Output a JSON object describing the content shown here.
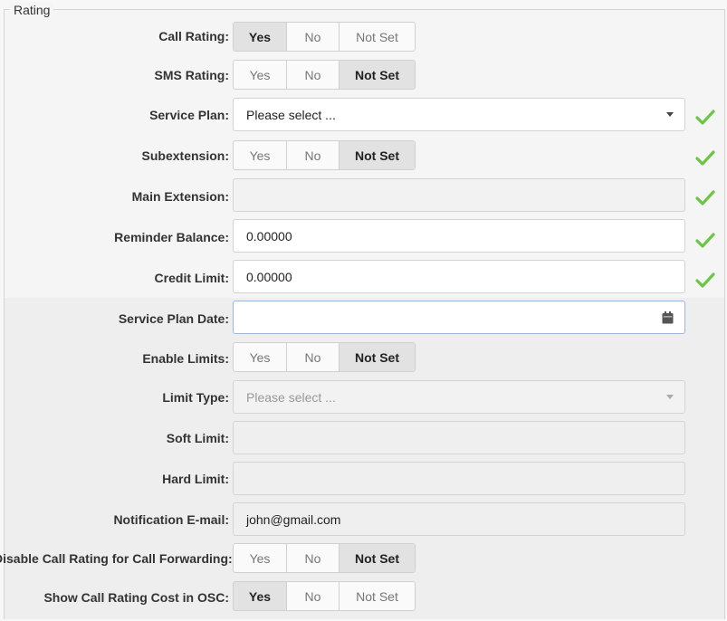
{
  "legend": "Rating",
  "options": {
    "yes": "Yes",
    "no": "No",
    "not_set": "Not Set"
  },
  "rows": {
    "call_rating": {
      "label": "Call Rating:",
      "selected": "Yes"
    },
    "sms_rating": {
      "label": "SMS Rating:",
      "selected": "Not Set"
    },
    "service_plan": {
      "label": "Service Plan:",
      "placeholder": "Please select ..."
    },
    "subextension": {
      "label": "Subextension:",
      "selected": "Not Set"
    },
    "main_extension": {
      "label": "Main Extension:",
      "value": ""
    },
    "reminder_balance": {
      "label": "Reminder Balance:",
      "value": "0.00000"
    },
    "credit_limit": {
      "label": "Credit Limit:",
      "value": "0.00000"
    },
    "service_plan_date": {
      "label": "Service Plan Date:",
      "value": ""
    },
    "enable_limits": {
      "label": "Enable Limits:",
      "selected": "Not Set"
    },
    "limit_type": {
      "label": "Limit Type:",
      "placeholder": "Please select ..."
    },
    "soft_limit": {
      "label": "Soft Limit:",
      "value": ""
    },
    "hard_limit": {
      "label": "Hard Limit:",
      "value": ""
    },
    "notification_email": {
      "label": "Notification E-mail:",
      "value": "john@gmail.com"
    },
    "disable_call_rating_forwarding": {
      "label": "Disable Call Rating for Call Forwarding:",
      "selected": "Not Set"
    },
    "show_call_rating_cost": {
      "label": "Show Call Rating Cost in OSC:",
      "selected": "Yes"
    }
  },
  "colors": {
    "check": "#6cc644",
    "active_option_bg": "#e2e2e2",
    "focus_border": "#9bb6d6"
  },
  "icons": {
    "check": "check-icon",
    "calendar": "calendar-icon",
    "dropdown": "chevron-down-icon"
  }
}
